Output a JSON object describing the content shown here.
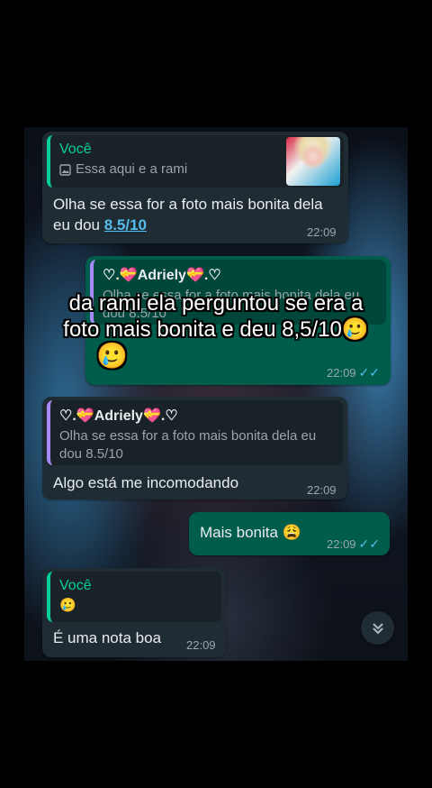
{
  "messages": [
    {
      "quote_name": "Você",
      "quote_text": "Essa aqui e a rami",
      "quote_icon": "image-icon",
      "text": "Olha se essa for a foto mais bonita dela eu dou ",
      "link": "8.5/10",
      "time": "22:09"
    },
    {
      "quote_name": "♡.💝Adriely💝.♡",
      "quote_text": "Olha se essa for a foto mais bonita dela eu dou 8.5/10",
      "time": "22:09",
      "ticks": "✓✓"
    },
    {
      "quote_name": "♡.💝Adriely💝.♡",
      "quote_text": "Olha se essa for a foto mais bonita dela eu dou 8.5/10",
      "text": "Algo está me incomodando",
      "time": "22:09"
    },
    {
      "text": "Mais bonita 😩",
      "time": "22:09",
      "ticks": "✓✓"
    },
    {
      "quote_name": "Você",
      "quote_text": "🥲",
      "text": "É uma nota boa",
      "time": "22:09"
    }
  ],
  "overlay": {
    "line1": "da rami ela perguntou se era a",
    "line2": "foto mais bonita e deu 8,5/10🥲",
    "line3": "🥲"
  },
  "scroll_button_icon": "double-chevron-down-icon",
  "colors": {
    "incoming": "#202c33",
    "outgoing": "#005c4b",
    "accent": "#06cf9c",
    "link": "#53bdeb"
  }
}
